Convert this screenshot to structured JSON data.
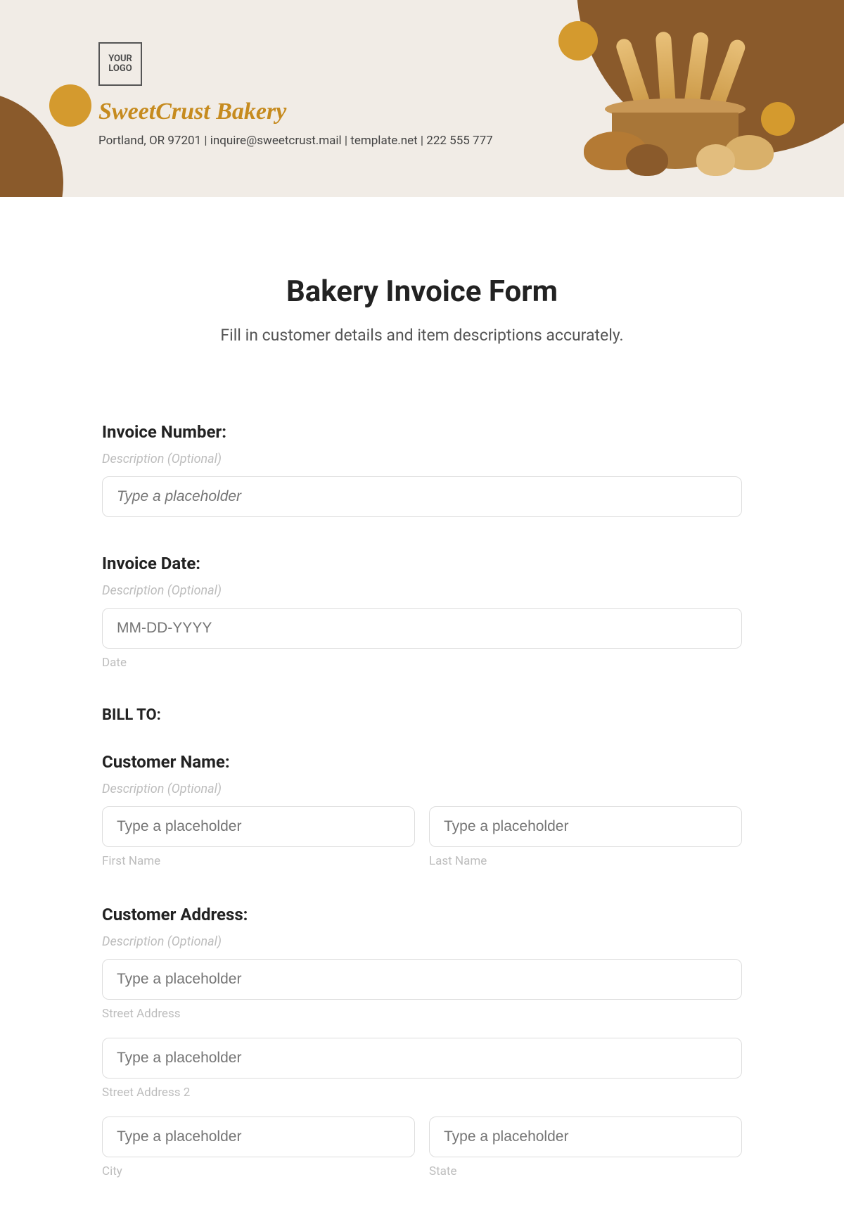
{
  "header": {
    "logo_text": "YOUR LOGO",
    "brand": "SweetCrust Bakery",
    "contact": "Portland, OR 97201 | inquire@sweetcrust.mail | template.net | 222 555 777"
  },
  "form": {
    "title": "Bakery Invoice Form",
    "subtitle": "Fill in customer details and item descriptions accurately.",
    "desc_optional": "Description (Optional)",
    "type_placeholder": "Type a placeholder",
    "invoice_number": {
      "label": "Invoice Number:"
    },
    "invoice_date": {
      "label": "Invoice Date:",
      "placeholder": "MM-DD-YYYY",
      "sublabel": "Date"
    },
    "bill_to": "BILL TO:",
    "customer_name": {
      "label": "Customer Name:",
      "first": "First Name",
      "last": "Last Name"
    },
    "customer_address": {
      "label": "Customer Address:",
      "street1": "Street Address",
      "street2": "Street Address 2",
      "city": "City",
      "state": "State"
    }
  }
}
